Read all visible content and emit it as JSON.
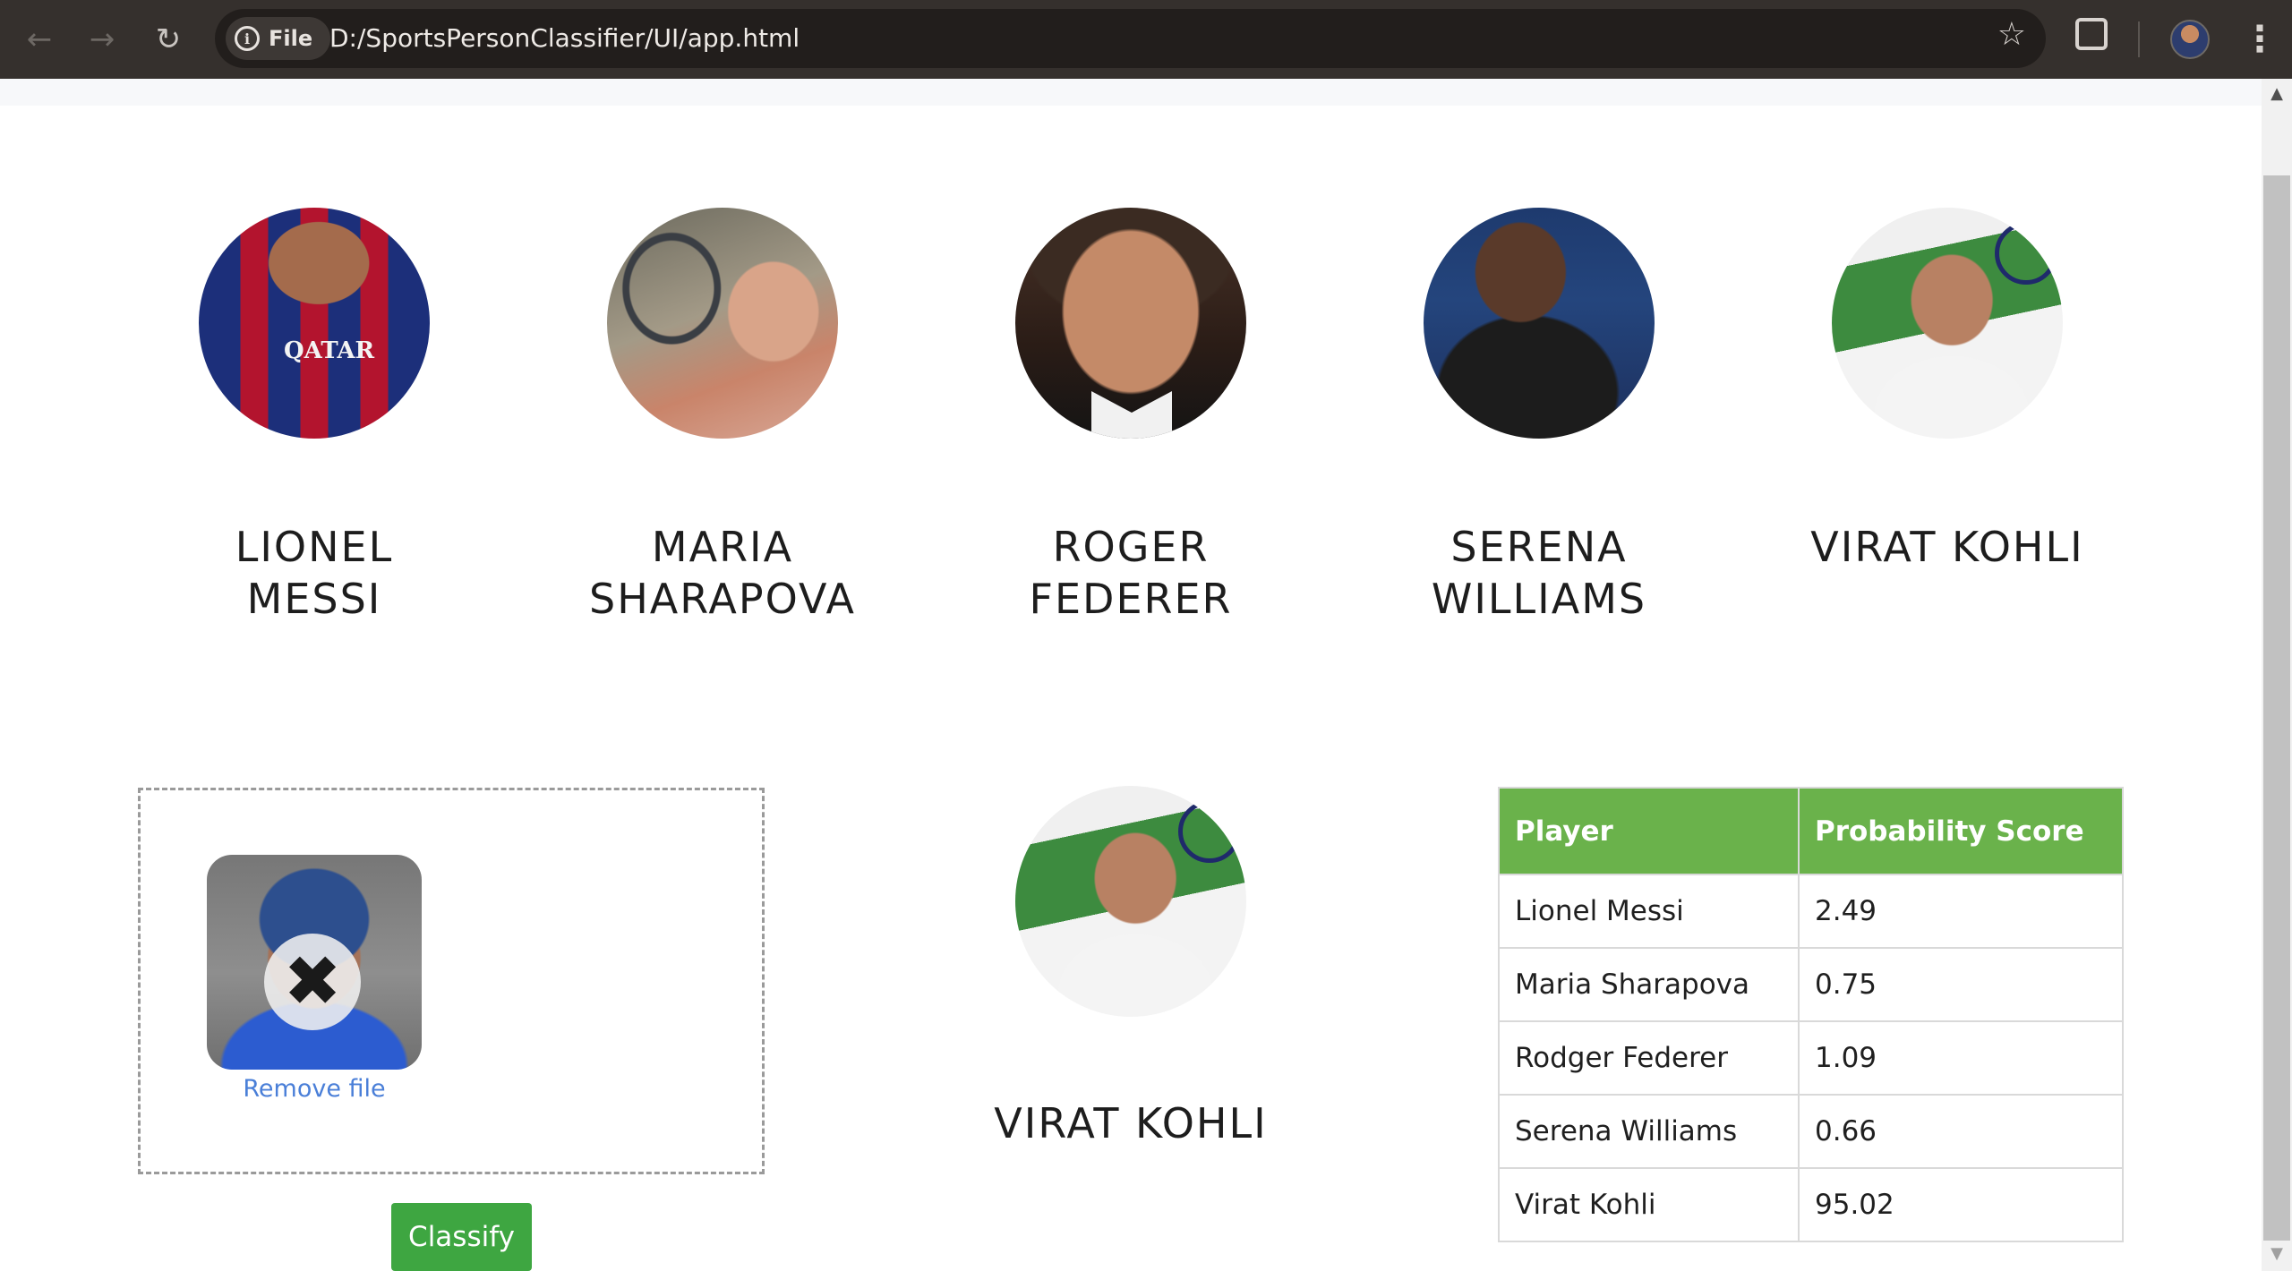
{
  "browser": {
    "file_chip_label": "File",
    "url": "D:/SportsPersonClassifier/UI/app.html",
    "icons": [
      "back-icon",
      "forward-icon",
      "reload-icon",
      "info-icon",
      "bookmark-star-icon",
      "extensions-icon",
      "profile-avatar",
      "more-menu-icon"
    ]
  },
  "players": [
    {
      "id": "messi",
      "name_line1": "LIONEL",
      "name_line2": "MESSI",
      "jersey_text": "QATAR"
    },
    {
      "id": "sharapova",
      "name_line1": "MARIA",
      "name_line2": "SHARAPOVA"
    },
    {
      "id": "federer",
      "name_line1": "ROGER",
      "name_line2": "FEDERER"
    },
    {
      "id": "serena",
      "name_line1": "SERENA",
      "name_line2": "WILLIAMS"
    },
    {
      "id": "kohli",
      "name_line1": "VIRAT KOHLI",
      "name_line2": ""
    }
  ],
  "upload": {
    "remove_label": "Remove file",
    "classify_label": "Classify"
  },
  "result": {
    "name": "VIRAT KOHLI"
  },
  "table": {
    "headers": [
      "Player",
      "Probability Score"
    ],
    "rows": [
      [
        "Lionel Messi",
        "2.49"
      ],
      [
        "Maria Sharapova",
        "0.75"
      ],
      [
        "Rodger Federer",
        "1.09"
      ],
      [
        "Serena Williams",
        "0.66"
      ],
      [
        "Virat Kohli",
        "95.02"
      ]
    ]
  },
  "colors": {
    "table_header": "#6ab24b",
    "classify_button": "#3ea641",
    "remove_link": "#4a7fd8",
    "chrome_bg": "#35302d"
  }
}
